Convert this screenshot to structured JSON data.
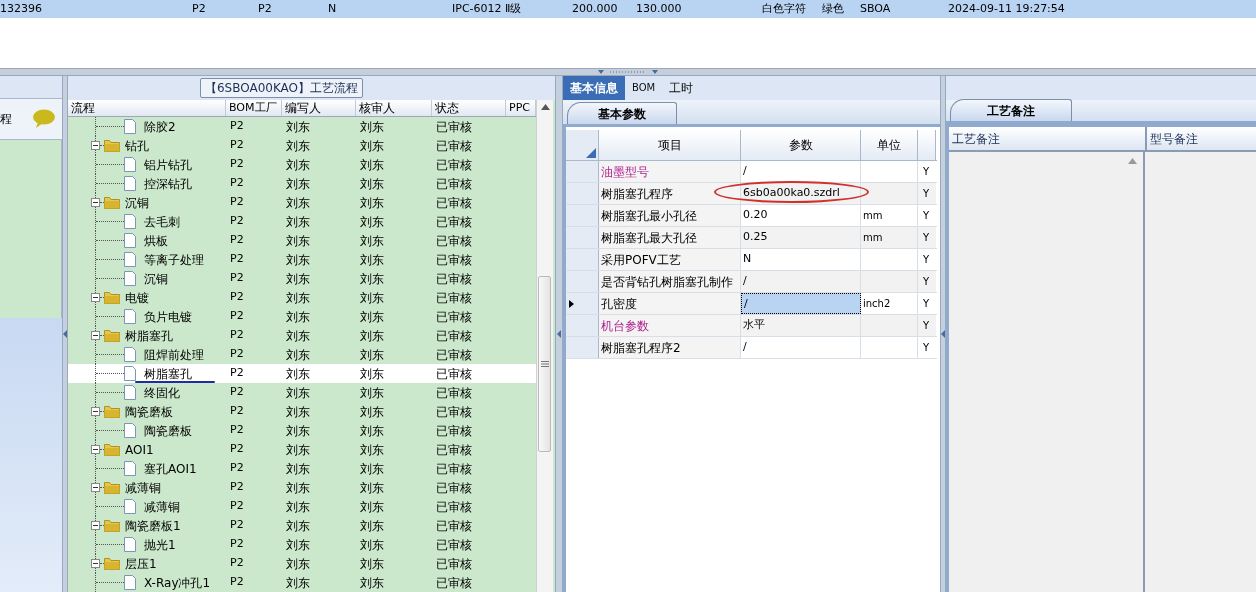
{
  "top_row": {
    "selected": true,
    "cells": [
      "132396",
      "P2",
      "P2",
      "N",
      "IPC-6012 Ⅱ级",
      "200.000",
      "130.000",
      "白色字符",
      "绿色",
      "SBOA",
      "2024-09-11 19:27:54"
    ]
  },
  "left_panel": {
    "label": "程"
  },
  "process_panel": {
    "title": "【6SBOA00KAO】工艺流程",
    "columns": [
      "流程",
      "BOM工厂",
      "编写人",
      "核审人",
      "状态",
      "PPC"
    ],
    "rows": [
      {
        "kind": "file",
        "name": "除胶2",
        "plant": "P2",
        "author": "刘东",
        "reviewer": "刘东",
        "status": "已审核",
        "selected": false
      },
      {
        "kind": "folder",
        "name": "钻孔",
        "expanded": true,
        "plant": "P2",
        "author": "刘东",
        "reviewer": "刘东",
        "status": "已审核",
        "selected": false,
        "children": [
          {
            "kind": "file",
            "name": "铝片钻孔",
            "plant": "P2",
            "author": "刘东",
            "reviewer": "刘东",
            "status": "已审核",
            "selected": false
          },
          {
            "kind": "file",
            "name": "控深钻孔",
            "plant": "P2",
            "author": "刘东",
            "reviewer": "刘东",
            "status": "已审核",
            "selected": false
          }
        ]
      },
      {
        "kind": "folder",
        "name": "沉铜",
        "expanded": true,
        "plant": "P2",
        "author": "刘东",
        "reviewer": "刘东",
        "status": "已审核",
        "selected": false,
        "children": [
          {
            "kind": "file",
            "name": "去毛刺",
            "plant": "P2",
            "author": "刘东",
            "reviewer": "刘东",
            "status": "已审核",
            "selected": false
          },
          {
            "kind": "file",
            "name": "烘板",
            "plant": "P2",
            "author": "刘东",
            "reviewer": "刘东",
            "status": "已审核",
            "selected": false
          },
          {
            "kind": "file",
            "name": "等离子处理",
            "plant": "P2",
            "author": "刘东",
            "reviewer": "刘东",
            "status": "已审核",
            "selected": false
          },
          {
            "kind": "file",
            "name": "沉铜",
            "plant": "P2",
            "author": "刘东",
            "reviewer": "刘东",
            "status": "已审核",
            "selected": false
          }
        ]
      },
      {
        "kind": "folder",
        "name": "电镀",
        "expanded": true,
        "plant": "P2",
        "author": "刘东",
        "reviewer": "刘东",
        "status": "已审核",
        "selected": false,
        "children": [
          {
            "kind": "file",
            "name": "负片电镀",
            "plant": "P2",
            "author": "刘东",
            "reviewer": "刘东",
            "status": "已审核",
            "selected": false
          }
        ]
      },
      {
        "kind": "folder",
        "name": "树脂塞孔",
        "expanded": true,
        "plant": "P2",
        "author": "刘东",
        "reviewer": "刘东",
        "status": "已审核",
        "selected": false,
        "children": [
          {
            "kind": "file",
            "name": "阻焊前处理",
            "plant": "P2",
            "author": "刘东",
            "reviewer": "刘东",
            "status": "已审核",
            "selected": false
          },
          {
            "kind": "file",
            "name": "树脂塞孔",
            "plant": "P2",
            "author": "刘东",
            "reviewer": "刘东",
            "status": "已审核",
            "selected": true
          },
          {
            "kind": "file",
            "name": "终固化",
            "plant": "P2",
            "author": "刘东",
            "reviewer": "刘东",
            "status": "已审核",
            "selected": false
          }
        ]
      },
      {
        "kind": "folder",
        "name": "陶瓷磨板",
        "expanded": true,
        "plant": "P2",
        "author": "刘东",
        "reviewer": "刘东",
        "status": "已审核",
        "selected": false,
        "children": [
          {
            "kind": "file",
            "name": "陶瓷磨板",
            "plant": "P2",
            "author": "刘东",
            "reviewer": "刘东",
            "status": "已审核",
            "selected": false
          }
        ]
      },
      {
        "kind": "folder",
        "name": "AOI1",
        "expanded": true,
        "plant": "P2",
        "author": "刘东",
        "reviewer": "刘东",
        "status": "已审核",
        "selected": false,
        "children": [
          {
            "kind": "file",
            "name": "塞孔AOI1",
            "plant": "P2",
            "author": "刘东",
            "reviewer": "刘东",
            "status": "已审核",
            "selected": false
          }
        ]
      },
      {
        "kind": "folder",
        "name": "减薄铜",
        "expanded": true,
        "plant": "P2",
        "author": "刘东",
        "reviewer": "刘东",
        "status": "已审核",
        "selected": false,
        "children": [
          {
            "kind": "file",
            "name": "减薄铜",
            "plant": "P2",
            "author": "刘东",
            "reviewer": "刘东",
            "status": "已审核",
            "selected": false
          }
        ]
      },
      {
        "kind": "folder",
        "name": "陶瓷磨板1",
        "expanded": true,
        "plant": "P2",
        "author": "刘东",
        "reviewer": "刘东",
        "status": "已审核",
        "selected": false,
        "children": [
          {
            "kind": "file",
            "name": "抛光1",
            "plant": "P2",
            "author": "刘东",
            "reviewer": "刘东",
            "status": "已审核",
            "selected": false
          }
        ]
      },
      {
        "kind": "folder",
        "name": "层压1",
        "expanded": true,
        "plant": "P2",
        "author": "刘东",
        "reviewer": "刘东",
        "status": "已审核",
        "selected": false,
        "children": [
          {
            "kind": "file",
            "name": "X-Ray冲孔1",
            "plant": "P2",
            "author": "刘东",
            "reviewer": "刘东",
            "status": "已审核",
            "selected": false
          }
        ]
      }
    ]
  },
  "info_tabs": [
    {
      "label": "基本信息",
      "selected": true
    },
    {
      "label": "BOM",
      "selected": false
    },
    {
      "label": "工时",
      "selected": false
    }
  ],
  "params_tab": {
    "label": "基本参数"
  },
  "params": {
    "columns": [
      "项目",
      "参数",
      "单位"
    ],
    "rows": [
      {
        "item": "油墨型号",
        "emphasized": true,
        "value": "/",
        "flag": "Y",
        "selected": false
      },
      {
        "item": "树脂塞孔程序",
        "emphasized": false,
        "value": "6sb0a00ka0.szdrl",
        "flag": "Y",
        "selected": false
      },
      {
        "item": "树脂塞孔最小孔径",
        "emphasized": false,
        "value": "0.20",
        "unit": "mm",
        "flag": "Y",
        "selected": false
      },
      {
        "item": "树脂塞孔最大孔径",
        "emphasized": false,
        "value": "0.25",
        "unit": "mm",
        "flag": "Y",
        "selected": false
      },
      {
        "item": "采用POFV工艺",
        "emphasized": false,
        "value": "N",
        "flag": "Y",
        "selected": false
      },
      {
        "item": "是否背钻孔树脂塞孔制作",
        "emphasized": false,
        "value": "/",
        "flag": "Y",
        "selected": false
      },
      {
        "item": "孔密度",
        "emphasized": false,
        "value": "/",
        "unit": "inch2",
        "flag": "Y",
        "selected": true
      },
      {
        "item": "机台参数",
        "emphasized": true,
        "value": "水平",
        "flag": "Y",
        "selected": false
      },
      {
        "item": "树脂塞孔程序2",
        "emphasized": false,
        "value": "/",
        "flag": "Y",
        "selected": false
      }
    ]
  },
  "notes_tab": {
    "label": "工艺备注"
  },
  "notes": {
    "columns": [
      "工艺备注",
      "型号备注"
    ]
  }
}
